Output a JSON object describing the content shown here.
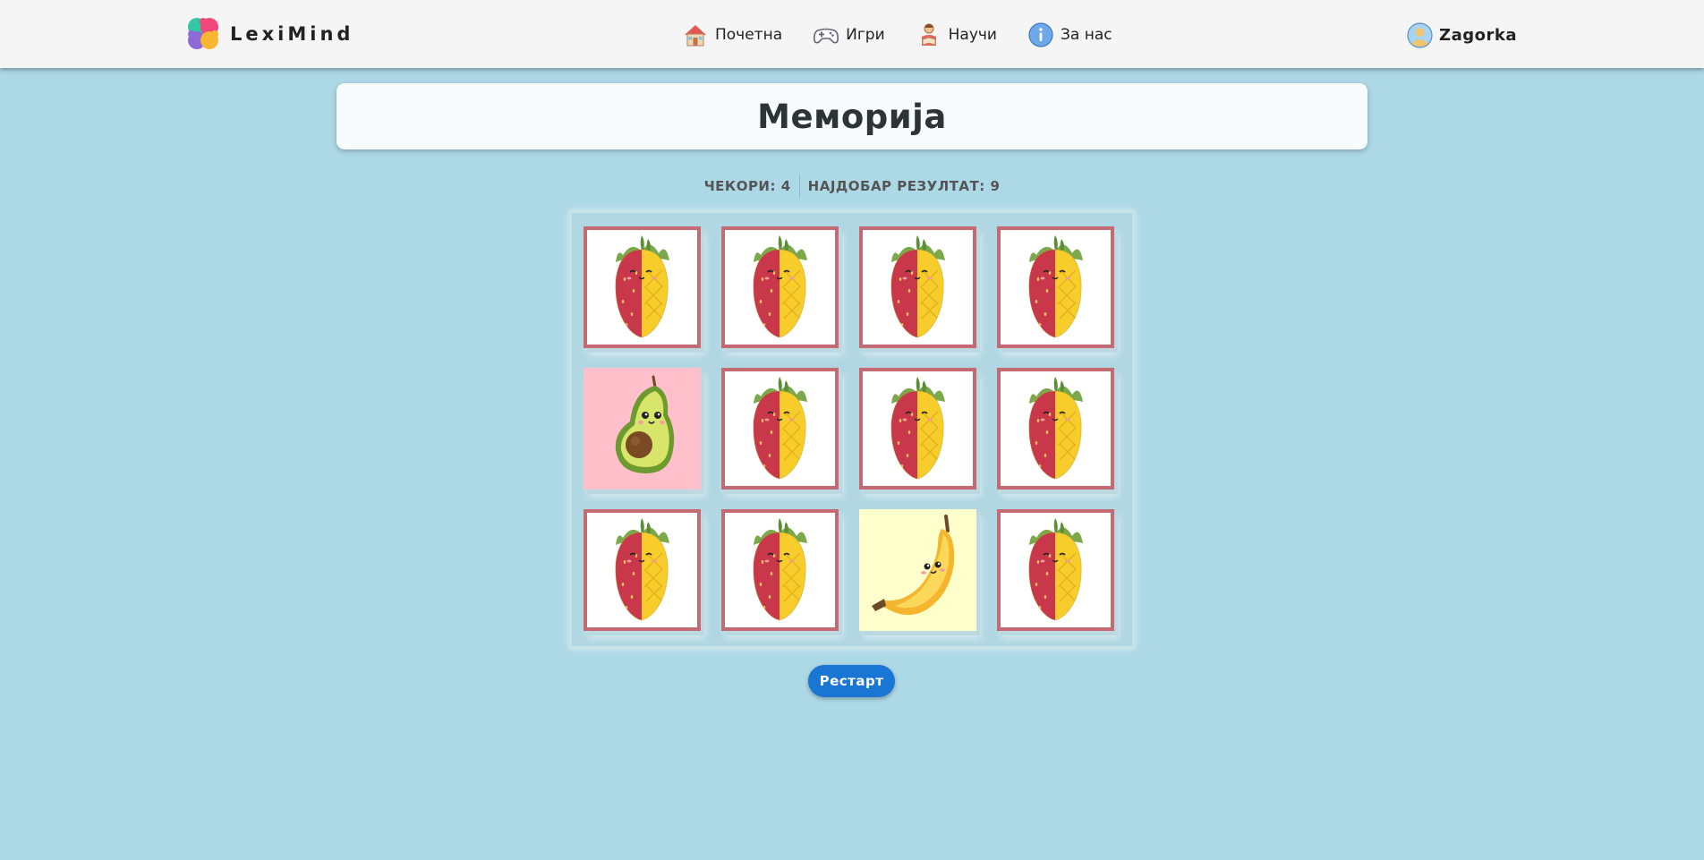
{
  "nav": {
    "brand": "LexiMind",
    "links": [
      {
        "label": "Почетна",
        "icon": "home-icon"
      },
      {
        "label": "Игри",
        "icon": "gamepad-icon"
      },
      {
        "label": "Научи",
        "icon": "reading-icon"
      },
      {
        "label": "За нас",
        "icon": "info-icon"
      }
    ],
    "user": "Zagorka"
  },
  "game": {
    "title": "Меморија",
    "stats": {
      "moves": "ЧЕКОРИ: 4",
      "best": "НАЈДОБАР РЕЗУЛТАТ: 9"
    },
    "restart_label": "Рестарт",
    "cards": [
      {
        "state": "face-down",
        "image": "strawberry-pineapple-card-back"
      },
      {
        "state": "face-down",
        "image": "strawberry-pineapple-card-back"
      },
      {
        "state": "face-down",
        "image": "strawberry-pineapple-card-back"
      },
      {
        "state": "face-down",
        "image": "strawberry-pineapple-card-back"
      },
      {
        "state": "face-up",
        "image": "avocado",
        "bg": "#ffc0cb"
      },
      {
        "state": "face-down",
        "image": "strawberry-pineapple-card-back"
      },
      {
        "state": "face-down",
        "image": "strawberry-pineapple-card-back"
      },
      {
        "state": "face-down",
        "image": "strawberry-pineapple-card-back"
      },
      {
        "state": "face-down",
        "image": "strawberry-pineapple-card-back"
      },
      {
        "state": "face-down",
        "image": "strawberry-pineapple-card-back"
      },
      {
        "state": "face-up",
        "image": "banana",
        "bg": "#ffffcc"
      },
      {
        "state": "face-down",
        "image": "strawberry-pineapple-card-back"
      }
    ]
  },
  "colors": {
    "page_bg": "#add8e6",
    "navbar_bg": "#f5f5f5",
    "card_back_border": "#c56a72",
    "button": "#1976d2"
  }
}
